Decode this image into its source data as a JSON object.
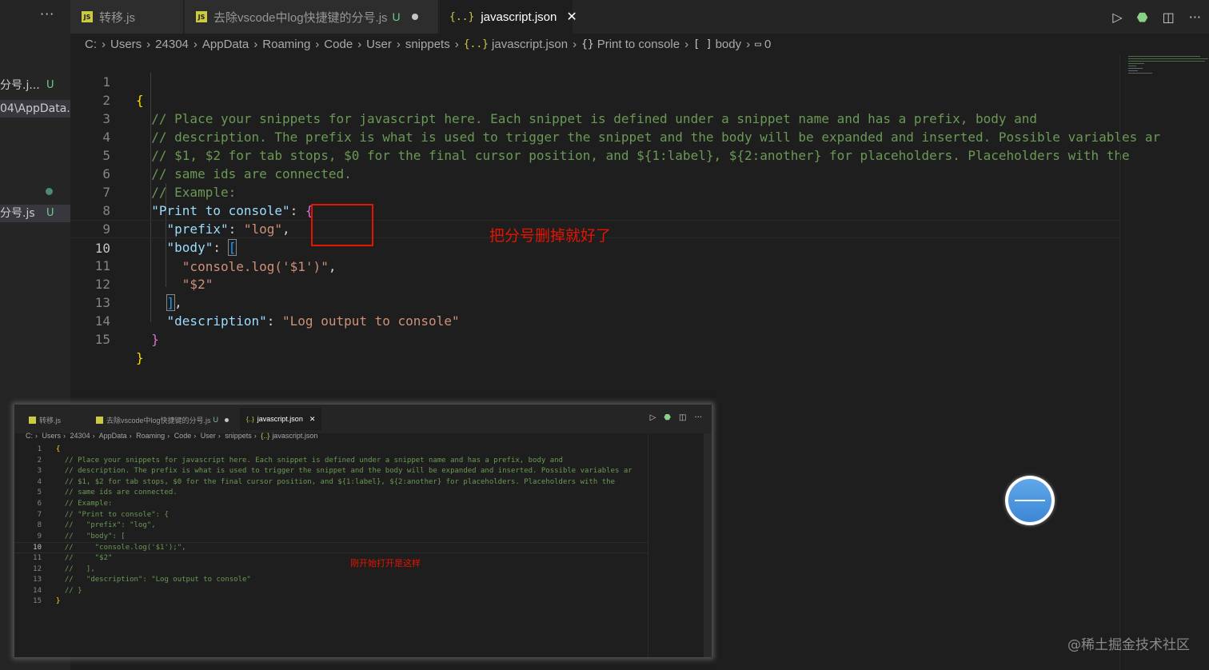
{
  "sidebar": {
    "more": "···",
    "items": [
      {
        "name": "分号.j...",
        "status": "U"
      },
      {
        "name": "04\\AppData..."
      },
      {
        "name": "分号.js",
        "status": "U"
      }
    ]
  },
  "tabs": [
    {
      "label": "转移.js"
    },
    {
      "label": "去除vscode中log快捷键的分号.js",
      "status": "U"
    },
    {
      "label": "javascript.json"
    }
  ],
  "breadcrumb": [
    "C:",
    "Users",
    "24304",
    "AppData",
    "Roaming",
    "Code",
    "User",
    "snippets",
    "javascript.json",
    "Print to console",
    "body",
    "0"
  ],
  "editor": {
    "lines": [
      {
        "n": "1"
      },
      {
        "n": "2",
        "text": "// Place your snippets for javascript here. Each snippet is defined under a snippet name and has a prefix, body and"
      },
      {
        "n": "3",
        "text": "// description. The prefix is what is used to trigger the snippet and the body will be expanded and inserted. Possible variables ar"
      },
      {
        "n": "4",
        "text": "// $1, $2 for tab stops, $0 for the final cursor position, and ${1:label}, ${2:another} for placeholders. Placeholders with the"
      },
      {
        "n": "5",
        "text": "// same ids are connected."
      },
      {
        "n": "6",
        "text": "// Example:"
      },
      {
        "n": "7",
        "key": "\"Print to console\""
      },
      {
        "n": "8",
        "key": "\"prefix\"",
        "value": "\"log\""
      },
      {
        "n": "9",
        "key": "\"body\""
      },
      {
        "n": "10",
        "value": "\"console.log('$1')\""
      },
      {
        "n": "11",
        "value": "\"$2\""
      },
      {
        "n": "12"
      },
      {
        "n": "13",
        "key": "\"description\"",
        "value": "\"Log output to console\""
      },
      {
        "n": "14"
      },
      {
        "n": "15"
      }
    ],
    "annotation": "把分号删掉就好了"
  },
  "screenshot": {
    "tabs": [
      {
        "label": "转移.js"
      },
      {
        "label": "去除vscode中log快捷键的分号.js",
        "status": "U"
      },
      {
        "label": "javascript.json"
      }
    ],
    "breadcrumb": [
      "C:",
      "Users",
      "24304",
      "AppData",
      "Roaming",
      "Code",
      "User",
      "snippets",
      "javascript.json"
    ],
    "lines": [
      {
        "n": "1",
        "text": "{"
      },
      {
        "n": "2",
        "text": "  // Place your snippets for javascript here. Each snippet is defined under a snippet name and has a prefix, body and"
      },
      {
        "n": "3",
        "text": "  // description. The prefix is what is used to trigger the snippet and the body will be expanded and inserted. Possible variables ar"
      },
      {
        "n": "4",
        "text": "  // $1, $2 for tab stops, $0 for the final cursor position, and ${1:label}, ${2:another} for placeholders. Placeholders with the"
      },
      {
        "n": "5",
        "text": "  // same ids are connected."
      },
      {
        "n": "6",
        "text": "  // Example:"
      },
      {
        "n": "7",
        "text": "  // \"Print to console\": {"
      },
      {
        "n": "8",
        "text": "  //   \"prefix\": \"log\","
      },
      {
        "n": "9",
        "text": "  //   \"body\": ["
      },
      {
        "n": "10",
        "text": "  //     \"console.log('$1');\","
      },
      {
        "n": "11",
        "text": "  //     \"$2\""
      },
      {
        "n": "12",
        "text": "  //   ],"
      },
      {
        "n": "13",
        "text": "  //   \"description\": \"Log output to console\""
      },
      {
        "n": "14",
        "text": "  // }"
      },
      {
        "n": "15",
        "text": "}"
      }
    ],
    "annotation": "刚开始打开是这样"
  },
  "watermark": "@稀土掘金技术社区",
  "colors": {
    "comment": "#6a9955",
    "key": "#9cdcfe",
    "string": "#ce9178",
    "annotation": "#e51400",
    "modified": "#73c991"
  }
}
